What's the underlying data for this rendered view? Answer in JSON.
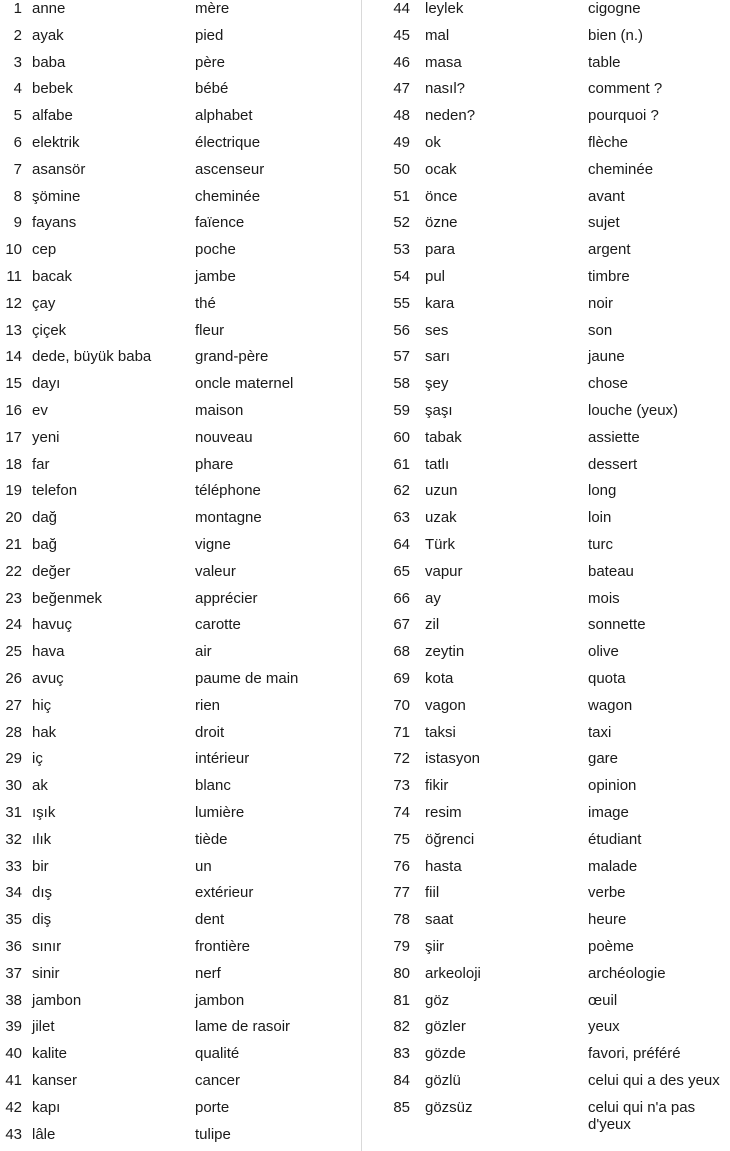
{
  "vocabulary": {
    "left": [
      {
        "n": "1",
        "tr": "anne",
        "fr": "mère"
      },
      {
        "n": "2",
        "tr": "ayak",
        "fr": "pied"
      },
      {
        "n": "3",
        "tr": "baba",
        "fr": "père"
      },
      {
        "n": "4",
        "tr": "bebek",
        "fr": "bébé"
      },
      {
        "n": "5",
        "tr": "alfabe",
        "fr": "alphabet"
      },
      {
        "n": "6",
        "tr": "elektrik",
        "fr": "électrique"
      },
      {
        "n": "7",
        "tr": "asansör",
        "fr": "ascenseur"
      },
      {
        "n": "8",
        "tr": "şömine",
        "fr": "cheminée"
      },
      {
        "n": "9",
        "tr": "fayans",
        "fr": "faïence"
      },
      {
        "n": "10",
        "tr": "cep",
        "fr": "poche"
      },
      {
        "n": "11",
        "tr": "bacak",
        "fr": "jambe"
      },
      {
        "n": "12",
        "tr": "çay",
        "fr": "thé"
      },
      {
        "n": "13",
        "tr": "çiçek",
        "fr": "fleur"
      },
      {
        "n": "14",
        "tr": "dede, büyük baba",
        "fr": "grand-père"
      },
      {
        "n": "15",
        "tr": "dayı",
        "fr": "oncle maternel"
      },
      {
        "n": "16",
        "tr": "ev",
        "fr": "maison"
      },
      {
        "n": "17",
        "tr": "yeni",
        "fr": "nouveau"
      },
      {
        "n": "18",
        "tr": "far",
        "fr": "phare"
      },
      {
        "n": "19",
        "tr": "telefon",
        "fr": "téléphone"
      },
      {
        "n": "20",
        "tr": "dağ",
        "fr": "montagne"
      },
      {
        "n": "21",
        "tr": "bağ",
        "fr": "vigne"
      },
      {
        "n": "22",
        "tr": "değer",
        "fr": "valeur"
      },
      {
        "n": "23",
        "tr": "beğenmek",
        "fr": "apprécier"
      },
      {
        "n": "24",
        "tr": "havuç",
        "fr": "carotte"
      },
      {
        "n": "25",
        "tr": "hava",
        "fr": "air"
      },
      {
        "n": "26",
        "tr": "avuç",
        "fr": "paume de main"
      },
      {
        "n": "27",
        "tr": "hiç",
        "fr": "rien"
      },
      {
        "n": "28",
        "tr": "hak",
        "fr": "droit"
      },
      {
        "n": "29",
        "tr": "iç",
        "fr": "intérieur"
      },
      {
        "n": "30",
        "tr": "ak",
        "fr": "blanc"
      },
      {
        "n": "31",
        "tr": "ışık",
        "fr": "lumière"
      },
      {
        "n": "32",
        "tr": "ılık",
        "fr": "tiède"
      },
      {
        "n": "33",
        "tr": "bir",
        "fr": "un"
      },
      {
        "n": "34",
        "tr": "dış",
        "fr": "extérieur"
      },
      {
        "n": "35",
        "tr": "diş",
        "fr": "dent"
      },
      {
        "n": "36",
        "tr": "sınır",
        "fr": "frontière"
      },
      {
        "n": "37",
        "tr": "sinir",
        "fr": "nerf"
      },
      {
        "n": "38",
        "tr": "jambon",
        "fr": "jambon"
      },
      {
        "n": "39",
        "tr": "jilet",
        "fr": "lame de rasoir"
      },
      {
        "n": "40",
        "tr": "kalite",
        "fr": "qualité"
      },
      {
        "n": "41",
        "tr": "kanser",
        "fr": "cancer"
      },
      {
        "n": "42",
        "tr": "kapı",
        "fr": "porte"
      },
      {
        "n": "43",
        "tr": "lâle",
        "fr": "tulipe"
      }
    ],
    "right": [
      {
        "n": "44",
        "tr": "leylek",
        "fr": "cigogne"
      },
      {
        "n": "45",
        "tr": "mal",
        "fr": "bien (n.)"
      },
      {
        "n": "46",
        "tr": "masa",
        "fr": "table"
      },
      {
        "n": "47",
        "tr": "nasıl?",
        "fr": "comment ?"
      },
      {
        "n": "48",
        "tr": "neden?",
        "fr": "pourquoi ?"
      },
      {
        "n": "49",
        "tr": "ok",
        "fr": "flèche"
      },
      {
        "n": "50",
        "tr": "ocak",
        "fr": "cheminée"
      },
      {
        "n": "51",
        "tr": "önce",
        "fr": "avant"
      },
      {
        "n": "52",
        "tr": "özne",
        "fr": "sujet"
      },
      {
        "n": "53",
        "tr": "para",
        "fr": "argent"
      },
      {
        "n": "54",
        "tr": "pul",
        "fr": "timbre"
      },
      {
        "n": "55",
        "tr": "kara",
        "fr": "noir"
      },
      {
        "n": "56",
        "tr": "ses",
        "fr": "son"
      },
      {
        "n": "57",
        "tr": "sarı",
        "fr": "jaune"
      },
      {
        "n": "58",
        "tr": "şey",
        "fr": "chose"
      },
      {
        "n": "59",
        "tr": "şaşı",
        "fr": "louche (yeux)"
      },
      {
        "n": "60",
        "tr": "tabak",
        "fr": "assiette"
      },
      {
        "n": "61",
        "tr": "tatlı",
        "fr": "dessert"
      },
      {
        "n": "62",
        "tr": "uzun",
        "fr": "long"
      },
      {
        "n": "63",
        "tr": "uzak",
        "fr": "loin"
      },
      {
        "n": "64",
        "tr": "Türk",
        "fr": "turc"
      },
      {
        "n": "65",
        "tr": "vapur",
        "fr": "bateau"
      },
      {
        "n": "66",
        "tr": "ay",
        "fr": "mois"
      },
      {
        "n": "67",
        "tr": "zil",
        "fr": "sonnette"
      },
      {
        "n": "68",
        "tr": "zeytin",
        "fr": "olive"
      },
      {
        "n": "69",
        "tr": "kota",
        "fr": "quota"
      },
      {
        "n": "70",
        "tr": "vagon",
        "fr": "wagon"
      },
      {
        "n": "71",
        "tr": "taksi",
        "fr": "taxi"
      },
      {
        "n": "72",
        "tr": "istasyon",
        "fr": "gare"
      },
      {
        "n": "73",
        "tr": "fikir",
        "fr": "opinion"
      },
      {
        "n": "74",
        "tr": "resim",
        "fr": "image"
      },
      {
        "n": "75",
        "tr": "öğrenci",
        "fr": "étudiant"
      },
      {
        "n": "76",
        "tr": "hasta",
        "fr": "malade"
      },
      {
        "n": "77",
        "tr": "fiil",
        "fr": "verbe"
      },
      {
        "n": "78",
        "tr": "saat",
        "fr": "heure"
      },
      {
        "n": "79",
        "tr": "şiir",
        "fr": "poème"
      },
      {
        "n": "80",
        "tr": "arkeoloji",
        "fr": "archéologie"
      },
      {
        "n": "81",
        "tr": "göz",
        "fr": "œuil"
      },
      {
        "n": "82",
        "tr": "gözler",
        "fr": "yeux"
      },
      {
        "n": "83",
        "tr": "gözde",
        "fr": "favori, préféré"
      },
      {
        "n": "84",
        "tr": "gözlü",
        "fr": "celui qui a des yeux"
      },
      {
        "n": "85",
        "tr": "gözsüz",
        "fr": "celui qui n'a pas d'yeux"
      }
    ]
  }
}
